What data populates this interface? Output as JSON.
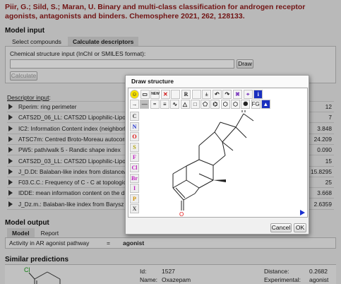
{
  "citation": "Piir, G.; Sild, S.; Maran, U. Binary and multi-class classification for androgen receptor agonists, antagonists and binders. Chemosphere 2021, 262, 128133.",
  "model_input": {
    "heading": "Model input",
    "tabs": [
      "Select compounds",
      "Calculate descriptors"
    ],
    "active_tab": 1,
    "structure_label": "Chemical structure input (InChI or SMILES format):",
    "structure_value": "",
    "draw_button": "Draw",
    "calculate_button": "Calculate",
    "descriptor_input_label": "Descriptor input",
    "descriptor_input_suffix": ":"
  },
  "descriptors": [
    {
      "name": "Rperim: ring perimeter",
      "value": "12"
    },
    {
      "name": "CATS2D_06_LL: CATS2D Lipophilic-Lipophi",
      "value": "7"
    },
    {
      "name": "IC2: Information Content index (neighborho",
      "value": "3.848"
    },
    {
      "name": "ATSC7m: Centred Broto-Moreau autocorrel",
      "value": "24.209"
    },
    {
      "name": "PW5: path/walk 5 - Randic shape index",
      "value": "0.090"
    },
    {
      "name": "CATS2D_03_LL: CATS2D Lipophilic-Lipophi",
      "value": "15"
    },
    {
      "name": "J_D.Dt: Balaban-like index from distance/de",
      "value": "15.8295"
    },
    {
      "name": "F03.C.C.: Frequency of C - C at topological",
      "value": "25"
    },
    {
      "name": "IDDE: mean information content on the dista",
      "value": "3.668"
    },
    {
      "name": "J_Dz.m.: Balaban-like index from Barysz ma",
      "value": "2.6359"
    }
  ],
  "model_output": {
    "heading": "Model output",
    "tabs": [
      "Model",
      "Report"
    ],
    "active_tab": 0,
    "result_label": "Activity in AR agonist pathway",
    "result_sep": "=",
    "result_value": "agonist"
  },
  "similar": {
    "heading": "Similar predictions",
    "molecule_atom": "Cl",
    "id_label": "Id:",
    "id_value": "1527",
    "name_label": "Name:",
    "name_value": "Oxazepam",
    "distance_label": "Distance:",
    "distance_value": "0.2682",
    "experimental_label": "Experimental:",
    "experimental_value": "agonist"
  },
  "dialog": {
    "title": "Draw structure",
    "cancel_button": "Cancel",
    "ok_button": "OK",
    "toolbar_row1": [
      "smiley-icon",
      "rectangle-select-icon",
      "new-icon",
      "delete-icon",
      "blank-icon",
      "rs-stereo-icon",
      "blank-icon",
      "charge-icon",
      "undo-icon",
      "redo-icon",
      "clear-icon",
      "center-icon",
      "info-icon"
    ],
    "toolbar_row1_text": {
      "new": "NEW",
      "rs": "R"
    },
    "toolbar_row2": [
      "chain-icon",
      "single-bond-icon",
      "double-bond-icon",
      "triple-bond-icon",
      "wavy-bond-icon",
      "triangle-ring-icon",
      "square-ring-icon",
      "pentagon-ring-icon",
      "benzene-ring-icon",
      "hexagon-ring-icon",
      "heptagon-ring-icon",
      "octagon-ring-icon",
      "fg-icon",
      "templates-icon"
    ],
    "fg_text": "FG",
    "atoms": [
      {
        "symbol": "C",
        "color": "#444444"
      },
      {
        "symbol": "N",
        "color": "#2030d0"
      },
      {
        "symbol": "O",
        "color": "#e01010"
      },
      {
        "symbol": "S",
        "color": "#b0a000"
      },
      {
        "symbol": "F",
        "color": "#c020c0"
      },
      {
        "symbol": "Cl",
        "color": "#c020c0"
      },
      {
        "symbol": "Br",
        "color": "#c020c0"
      },
      {
        "symbol": "I",
        "color": "#c020c0"
      },
      {
        "symbol": "P",
        "color": "#d09000"
      },
      {
        "symbol": "X",
        "color": "#444444"
      }
    ],
    "oxygen_label": "O"
  }
}
